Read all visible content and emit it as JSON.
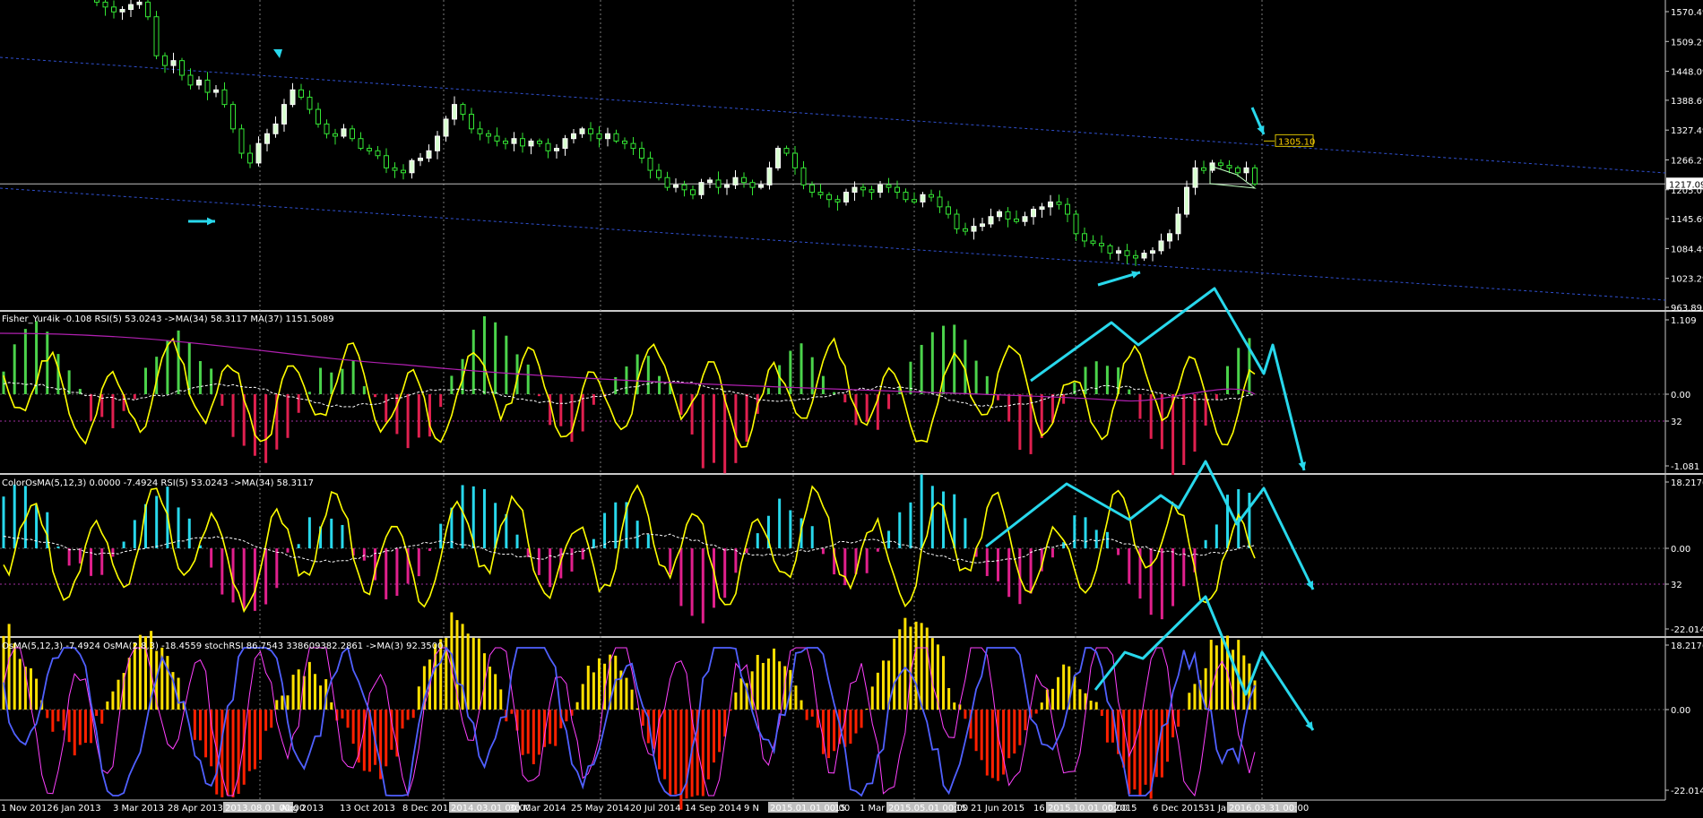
{
  "window": {
    "price_label": "1305.10",
    "current_price_label": "1217.09"
  },
  "chart_data": [
    {
      "type": "candlestick",
      "panel": "price",
      "y_ticks": [
        "1570.49",
        "1509.29",
        "1448.09",
        "1388.69",
        "1327.49",
        "1266.29",
        "1205.09",
        "1145.69",
        "1084.49",
        "1023.29",
        "963.89"
      ],
      "ylim": [
        963.89,
        1600
      ],
      "current_price": 1217.09,
      "marked_level": 1305.1,
      "grid": "dotted vertical",
      "closes_weekly": [
        1590,
        1580,
        1570,
        1575,
        1585,
        1590,
        1560,
        1480,
        1460,
        1470,
        1440,
        1420,
        1430,
        1405,
        1410,
        1380,
        1330,
        1280,
        1260,
        1300,
        1320,
        1340,
        1380,
        1410,
        1395,
        1370,
        1340,
        1320,
        1315,
        1330,
        1310,
        1290,
        1285,
        1275,
        1250,
        1245,
        1240,
        1265,
        1270,
        1285,
        1315,
        1350,
        1380,
        1360,
        1330,
        1320,
        1315,
        1305,
        1300,
        1310,
        1295,
        1305,
        1300,
        1285,
        1290,
        1310,
        1320,
        1330,
        1320,
        1310,
        1320,
        1305,
        1300,
        1290,
        1270,
        1245,
        1230,
        1210,
        1215,
        1205,
        1195,
        1220,
        1225,
        1210,
        1215,
        1230,
        1220,
        1210,
        1215,
        1250,
        1290,
        1280,
        1250,
        1215,
        1200,
        1195,
        1185,
        1180,
        1200,
        1210,
        1205,
        1200,
        1215,
        1210,
        1200,
        1185,
        1180,
        1195,
        1190,
        1170,
        1155,
        1125,
        1120,
        1130,
        1135,
        1150,
        1160,
        1145,
        1140,
        1150,
        1165,
        1170,
        1180,
        1175,
        1155,
        1115,
        1100,
        1095,
        1090,
        1075,
        1080,
        1070,
        1065,
        1075,
        1080,
        1100,
        1115,
        1155,
        1210,
        1250,
        1245,
        1260,
        1255,
        1250,
        1240,
        1250,
        1217
      ],
      "title": ""
    },
    {
      "type": "histogram+line",
      "panel": "Fisher",
      "header": "Fisher_Yur4ik -0.108  RSI(5) 53.0243  ->MA(34) 58.3117  MA(37) 1151.5089",
      "y_ticks": [
        "1.109",
        "0.00",
        "32",
        "-1.081"
      ],
      "ylim": [
        -1.081,
        1.109
      ]
    },
    {
      "type": "histogram+line",
      "panel": "ColorOsMA",
      "header": "ColorOsMA(5,12,3) 0.0000 -7.4924  RSI(5) 53.0243  ->MA(34) 58.3117",
      "y_ticks": [
        "18.2176",
        "0.00",
        "32",
        "-22.014"
      ],
      "ylim": [
        -22.014,
        18.2176
      ]
    },
    {
      "type": "histogram+line",
      "panel": "OsMA",
      "header": "OsMA(5,12,3) -7.4924  OsMA(2,8,3) -18.4559  stochRSI 86.7543 338609382.2861  ->MA(3) 92.3500",
      "y_ticks": [
        "18.2176",
        "0.00",
        "-22.014"
      ],
      "ylim": [
        -22.014,
        18.2176
      ]
    }
  ],
  "x_axis": {
    "labels": [
      "1 Nov 2012",
      "6 Jan 2013",
      "3 Mar 2013",
      "28 Apr 2013",
      "2013.08.01 00:00",
      "Aug 2013",
      "13 Oct 2013",
      "8 Dec 2013",
      "2014.03.01 00:00",
      "30 Mar 2014",
      "25 May 2014",
      "20 Jul 2014",
      "14 Sep 2014",
      "9 N",
      "2015.01.01 00:00",
      "15",
      "1 Mar",
      "2015.05.01 00:00",
      "15",
      "21 Jun 2015",
      "16",
      "2015.10.01 00:00",
      "t 2015",
      "6 Dec 2015",
      "31 Jan",
      "2016.03.31 00:00"
    ]
  },
  "colors": {
    "background": "#000000",
    "bull": "#ffffff",
    "bear": "#35e635",
    "candle_bull_fill": "#d8ffd0",
    "green_bar": "#4bd34b",
    "red_bar": "#e0204f",
    "cyan_bar": "#28d8ec",
    "magenta_bar": "#e0208c",
    "yellow_line": "#ffff00",
    "blue_line": "#5060ff",
    "arrow": "#28d8ec",
    "channel": "#3050d0"
  }
}
